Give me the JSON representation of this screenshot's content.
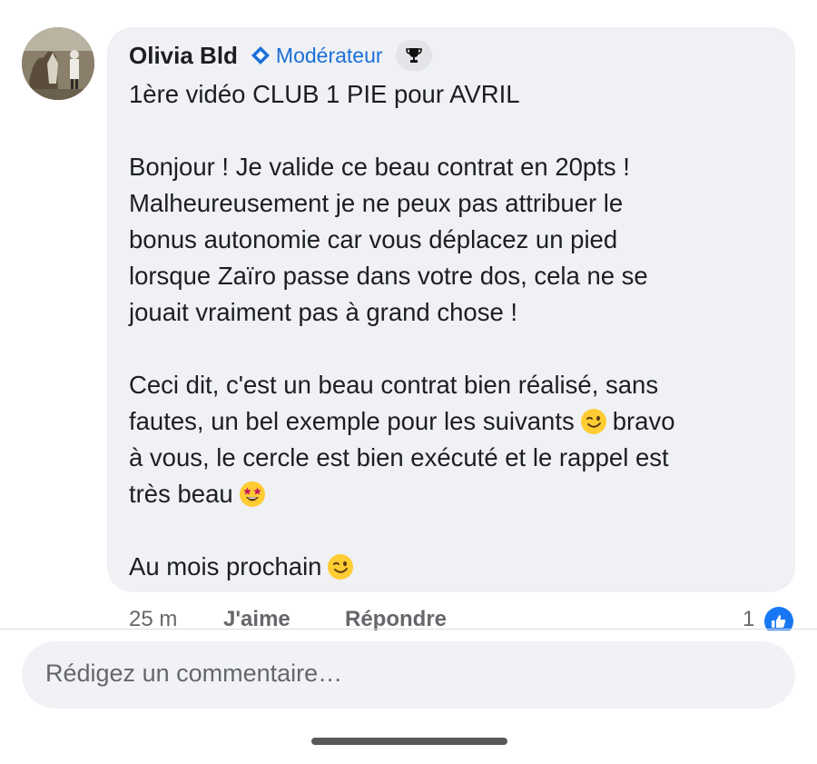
{
  "comment": {
    "author": "Olivia Bld",
    "badge_label": "Modérateur",
    "badge_icon": "moderator-diamond-icon",
    "trophy_icon": "trophy-icon",
    "lines": [
      "1ère vidéo CLUB 1 PIE pour AVRIL",
      "",
      "Bonjour ! Je valide ce beau contrat en 20pts !",
      "Malheureusement je ne peux pas attribuer le",
      "bonus autonomie car vous déplacez un pied",
      "lorsque Zaïro passe dans votre dos, cela ne se",
      "jouait vraiment pas à grand chose !",
      "",
      "Ceci dit, c'est un beau contrat bien réalisé, sans",
      "fautes, un bel exemple pour les suivants",
      "bravo",
      "à vous, le cercle est bien exécuté et le rappel est",
      "très beau",
      "",
      "Au mois prochain"
    ],
    "emojis": [
      "wink-emoji-icon",
      "star-struck-emoji-icon",
      "wink-emoji-icon"
    ]
  },
  "meta": {
    "time": "25 m",
    "like_label": "J'aime",
    "reply_label": "Répondre",
    "reaction_count": "1",
    "reaction_icon": "thumbs-up-icon"
  },
  "composer": {
    "placeholder": "Rédigez un commentaire…"
  },
  "colors": {
    "bubble": "#f0f1f4",
    "accent": "#1877f2",
    "badge": "#1b6fd8",
    "muted": "#65676b"
  }
}
